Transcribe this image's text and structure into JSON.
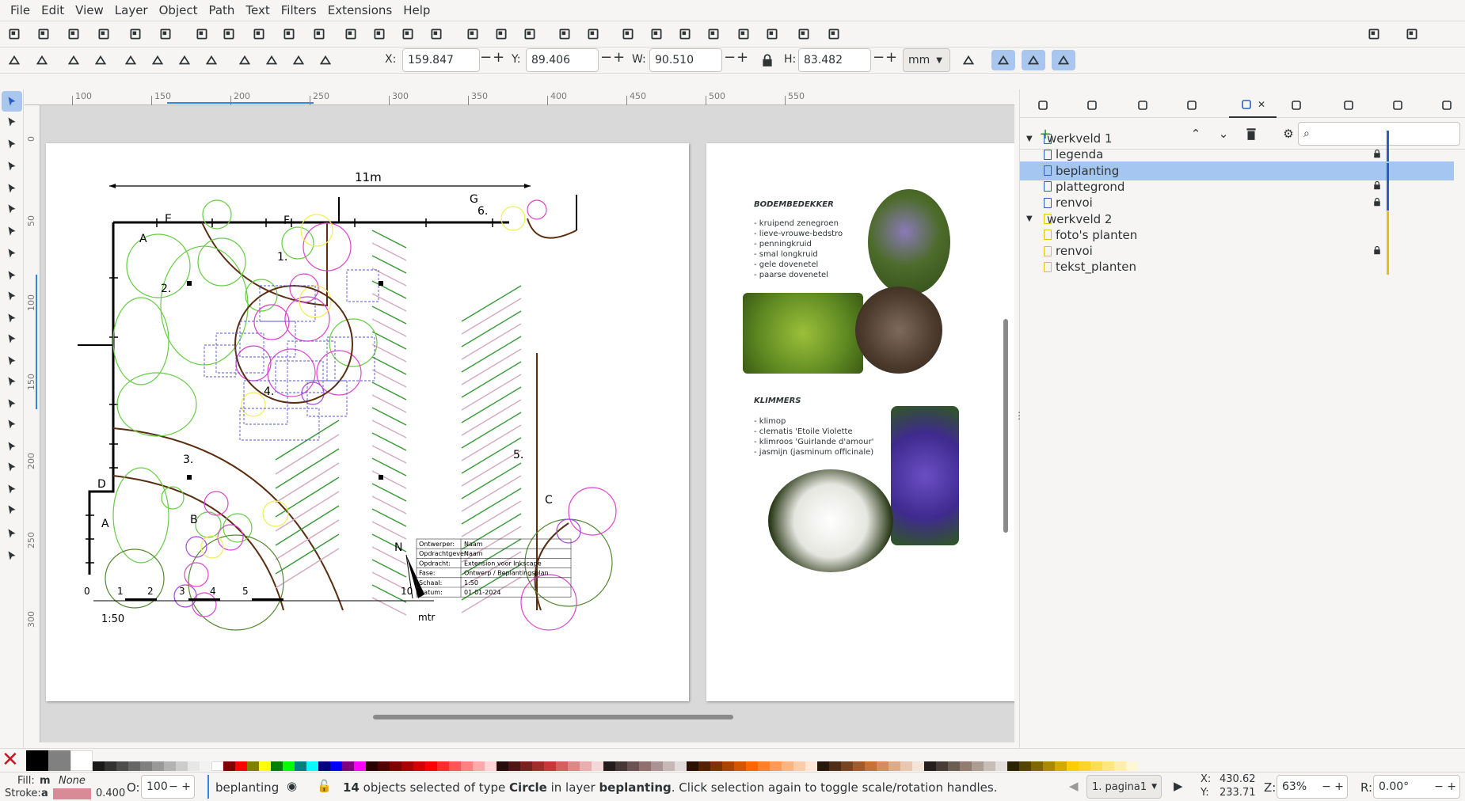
{
  "menu": [
    "File",
    "Edit",
    "View",
    "Layer",
    "Object",
    "Path",
    "Text",
    "Filters",
    "Extensions",
    "Help"
  ],
  "toolbar2": {
    "x_label": "X:",
    "x_value": "159.847",
    "y_label": "Y:",
    "y_value": "89.406",
    "w_label": "W:",
    "w_value": "90.510",
    "h_label": "H:",
    "h_value": "83.482",
    "unit": "mm"
  },
  "ruler_top": [
    "100",
    "150",
    "200",
    "250",
    "300",
    "350",
    "400",
    "450",
    "500",
    "550"
  ],
  "ruler_left": [
    "0",
    "50",
    "100",
    "150",
    "200",
    "250",
    "300"
  ],
  "drawing": {
    "dimension": "11m",
    "labels": [
      "A",
      "2.",
      "E",
      "F",
      "1.",
      "G",
      "6.",
      "4.",
      "3.",
      "D",
      "A",
      "B",
      "5.",
      "C"
    ],
    "north": "N",
    "scale_nums": [
      "0",
      "1",
      "2",
      "3",
      "4",
      "5",
      "10"
    ],
    "scale_unit": "mtr",
    "scale_ratio": "1:50",
    "title_block": [
      [
        "Ontwerper:",
        "Naam"
      ],
      [
        "Opdrachtgever:",
        "Naam"
      ],
      [
        "Opdracht:",
        "Extension voor Inkscape"
      ],
      [
        "Fase:",
        "Ontwerp / Beplantingsplan"
      ],
      [
        "Schaal:",
        "1:50"
      ],
      [
        "Datum:",
        "01-01-2024"
      ]
    ]
  },
  "page2": {
    "heading1": "BODEMBEDEKKER",
    "list1": [
      "- kruipend zenegroen",
      "- lieve-vrouwe-bedstro",
      "- penningkruid",
      "- smal longkruid",
      "- gele dovenetel",
      "- paarse dovenetel"
    ],
    "heading2": "KLIMMERS",
    "list2": [
      "- klimop",
      "- clematis 'Etoile Violette",
      "- klimroos 'Guirlande d'amour'",
      "- jasmijn (jasminum officinale)"
    ]
  },
  "layers": [
    {
      "name": "werkveld 1",
      "level": 0,
      "locked": false,
      "selected": false,
      "color": "#2a5fc1"
    },
    {
      "name": "legenda",
      "level": 1,
      "locked": true,
      "selected": false,
      "color": "#2a5fc1"
    },
    {
      "name": "beplanting",
      "level": 1,
      "locked": false,
      "selected": true,
      "color": "#2a5fc1"
    },
    {
      "name": "plattegrond",
      "level": 1,
      "locked": true,
      "selected": false,
      "color": "#2a5fc1"
    },
    {
      "name": "renvoi",
      "level": 1,
      "locked": true,
      "selected": false,
      "color": "#2a5fc1"
    },
    {
      "name": "werkveld 2",
      "level": 0,
      "locked": false,
      "selected": false,
      "color": "#e6c300"
    },
    {
      "name": "foto's planten",
      "level": 1,
      "locked": false,
      "selected": false,
      "color": "#e6c300"
    },
    {
      "name": "renvoi",
      "level": 1,
      "locked": true,
      "selected": false,
      "color": "#e6c300"
    },
    {
      "name": "tekst_planten",
      "level": 1,
      "locked": false,
      "selected": false,
      "color": "#e6c300"
    }
  ],
  "status": {
    "fill_label": "Fill:",
    "fill_value": "m",
    "fill_none": "None",
    "stroke_label": "Stroke:",
    "stroke_value": "a",
    "stroke_width": "0.400",
    "opacity_label": "O:",
    "opacity_value": "100",
    "layer_name": "beplanting",
    "message_count": "14",
    "message_mid": " objects selected of type ",
    "message_type": "Circle",
    "message_mid2": " in layer ",
    "message_layer": "beplanting",
    "message_end": ". Click selection again to toggle scale/rotation handles.",
    "page": "1. pagina1",
    "cursor_x_label": "X:",
    "cursor_x": "430.62",
    "cursor_y_label": "Y:",
    "cursor_y": "233.71",
    "zoom_label": "Z:",
    "zoom": "63%",
    "rotate_label": "R:",
    "rotate": "0.00°"
  },
  "palette_colors": [
    "#000000",
    "#808080",
    "#ffffff",
    "#1a1a1a",
    "#333333",
    "#4d4d4d",
    "#666666",
    "#808080",
    "#999999",
    "#b3b3b3",
    "#cccccc",
    "#e6e6e6",
    "#f2f2f2",
    "#ffffff",
    "#800000",
    "#ff0000",
    "#808000",
    "#ffff00",
    "#008000",
    "#00ff00",
    "#008080",
    "#00ffff",
    "#000080",
    "#0000ff",
    "#800080",
    "#ff00ff",
    "#2b0000",
    "#550000",
    "#800000",
    "#aa0000",
    "#d40000",
    "#ff0000",
    "#ff2a2a",
    "#ff5555",
    "#ff8080",
    "#ffaaaa",
    "#ffd5d5",
    "#280b0b",
    "#501616",
    "#782121",
    "#a02c2c",
    "#c83737",
    "#d35f5f",
    "#de8787",
    "#e9afaf",
    "#f4d7d7",
    "#241c1c",
    "#483737",
    "#6c5353",
    "#916f6f",
    "#ac9393",
    "#c8b7b7",
    "#e3dbdb",
    "#2b1100",
    "#552200",
    "#803300",
    "#aa4400",
    "#d45500",
    "#ff6600",
    "#ff7f2a",
    "#ff9955",
    "#ffb380",
    "#ffccaa",
    "#ffe6d5",
    "#28170b",
    "#502d16",
    "#784421",
    "#a05a2c",
    "#c87137",
    "#d38d5f",
    "#deaa87",
    "#e9c6af",
    "#f4e3d7",
    "#241f1c",
    "#483e37",
    "#6c5d53",
    "#917c6f",
    "#ac9d93",
    "#c8beb7",
    "#e3dedb",
    "#2b2200",
    "#554400",
    "#806600",
    "#aa8800",
    "#d4aa00",
    "#ffcc00",
    "#ffd42a",
    "#ffdd55",
    "#ffe680",
    "#ffeeaa",
    "#fff6d5"
  ],
  "colors": {
    "selected_layer": "#a5c6f0",
    "accent": "#3584e4",
    "stroke_swatch": "#d88a96"
  }
}
